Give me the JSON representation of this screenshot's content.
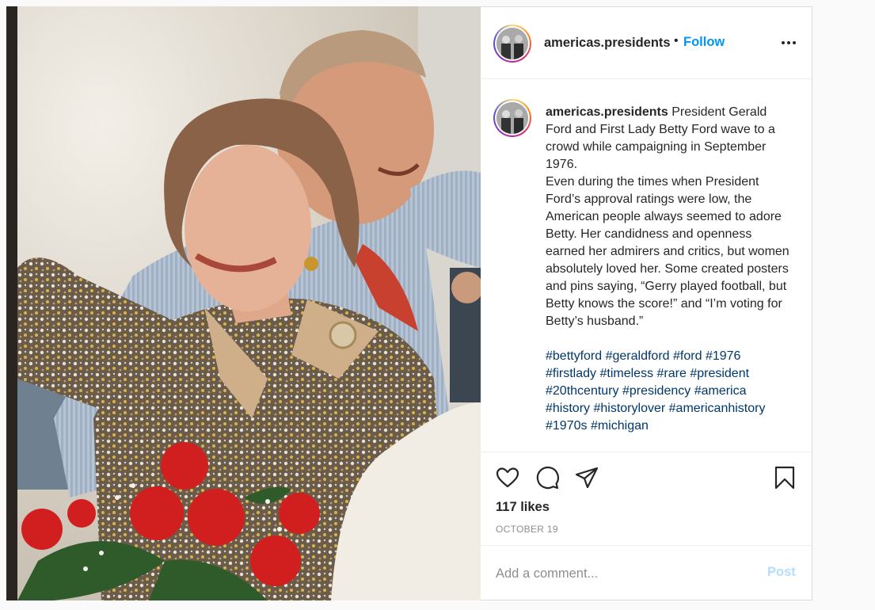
{
  "post": {
    "username": "americas.presidents",
    "separator": "•",
    "follow_label": "Follow",
    "more_icon": "more-horizontal-icon",
    "caption": {
      "username": "americas.presidents",
      "line1": "President Gerald Ford and First Lady Betty Ford wave to a crowd while campaigning in September 1976.",
      "line2": "Even during the times when President Ford’s approval ratings were low, the American people always seemed to adore Betty. Her candidness and openness earned her admirers and critics, but women absolutely loved her. Some created posters and pins saying, “Gerry played football, but Betty knows the score!” and “I’m voting for Betty’s husband.”",
      "hashtags": [
        "#bettyford",
        "#geraldford",
        "#ford",
        "#1976",
        "#firstlady",
        "#timeless",
        "#rare",
        "#president",
        "#20thcentury",
        "#presidency",
        "#america",
        "#history",
        "#historylover",
        "#americanhistory",
        "#1970s",
        "#michigan"
      ]
    },
    "likes_text": "117 likes",
    "date_text": "OCTOBER 19",
    "comment": {
      "placeholder": "Add a comment...",
      "post_label": "Post"
    },
    "icons": [
      "heart-icon",
      "comment-icon",
      "share-icon",
      "bookmark-icon"
    ],
    "colors": {
      "link": "#0095f6",
      "hashtag": "#00376b",
      "post_disabled": "#b2dffc",
      "muted": "#8e8e8e"
    }
  }
}
